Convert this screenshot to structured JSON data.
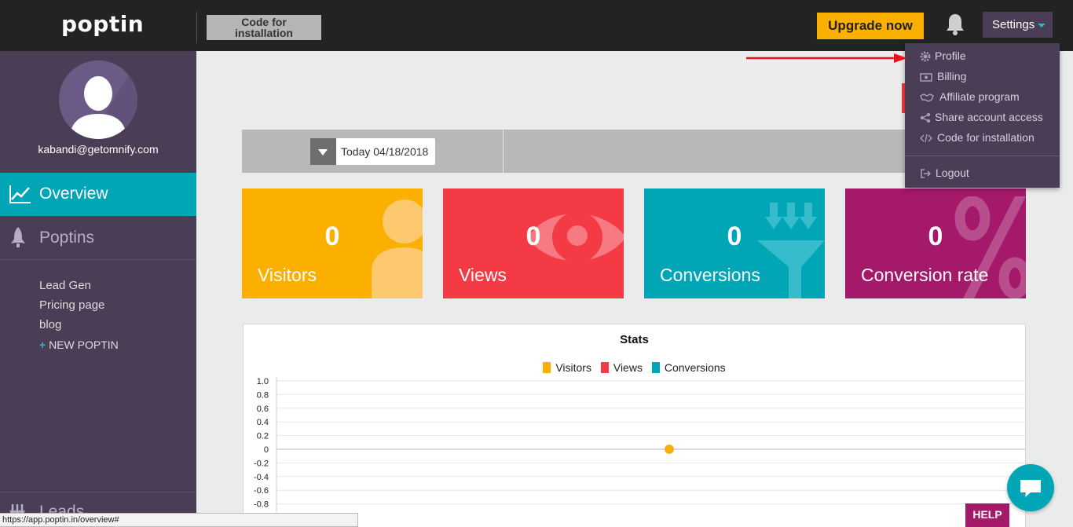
{
  "header": {
    "logo": "poptin",
    "code_btn_line1": "Code for",
    "code_btn_line2": "installation",
    "upgrade": "Upgrade now",
    "settings": "Settings"
  },
  "sidebar": {
    "email": "kabandi@getomnify.com",
    "overview": "Overview",
    "poptins": "Poptins",
    "sub_items": [
      "Lead Gen",
      "Pricing page",
      "blog"
    ],
    "new_poptin": "NEW POPTIN",
    "leads": "Leads"
  },
  "filter": {
    "date": "Today 04/18/2018"
  },
  "cards": [
    {
      "value": "0",
      "label": "Visitors",
      "color": "#fbb000"
    },
    {
      "value": "0",
      "label": "Views",
      "color": "#f33a45"
    },
    {
      "value": "0",
      "label": "Conversions",
      "color": "#00a5b6"
    },
    {
      "value": "0",
      "label": "Conversion rate",
      "color": "#a5196a"
    }
  ],
  "dropdown": {
    "items": [
      "Profile",
      "Billing",
      "Affiliate program",
      "Share account access",
      "Code for installation"
    ],
    "logout": "Logout"
  },
  "statusbar": "https://app.poptin.in/overview#",
  "help": "HELP",
  "chart_data": {
    "type": "line",
    "title": "Stats",
    "series": [
      {
        "name": "Visitors",
        "color": "#fbb000",
        "values": [
          0
        ]
      },
      {
        "name": "Views",
        "color": "#f33a45",
        "values": [
          0
        ]
      },
      {
        "name": "Conversions",
        "color": "#00a5b6",
        "values": [
          0
        ]
      }
    ],
    "ylim": [
      -1.0,
      1.0
    ],
    "yticks": [
      "1.0",
      "0.8",
      "0.6",
      "0.4",
      "0.2",
      "0",
      "-0.2",
      "-0.4",
      "-0.6",
      "-0.8"
    ],
    "legend": "top",
    "grid": true
  }
}
